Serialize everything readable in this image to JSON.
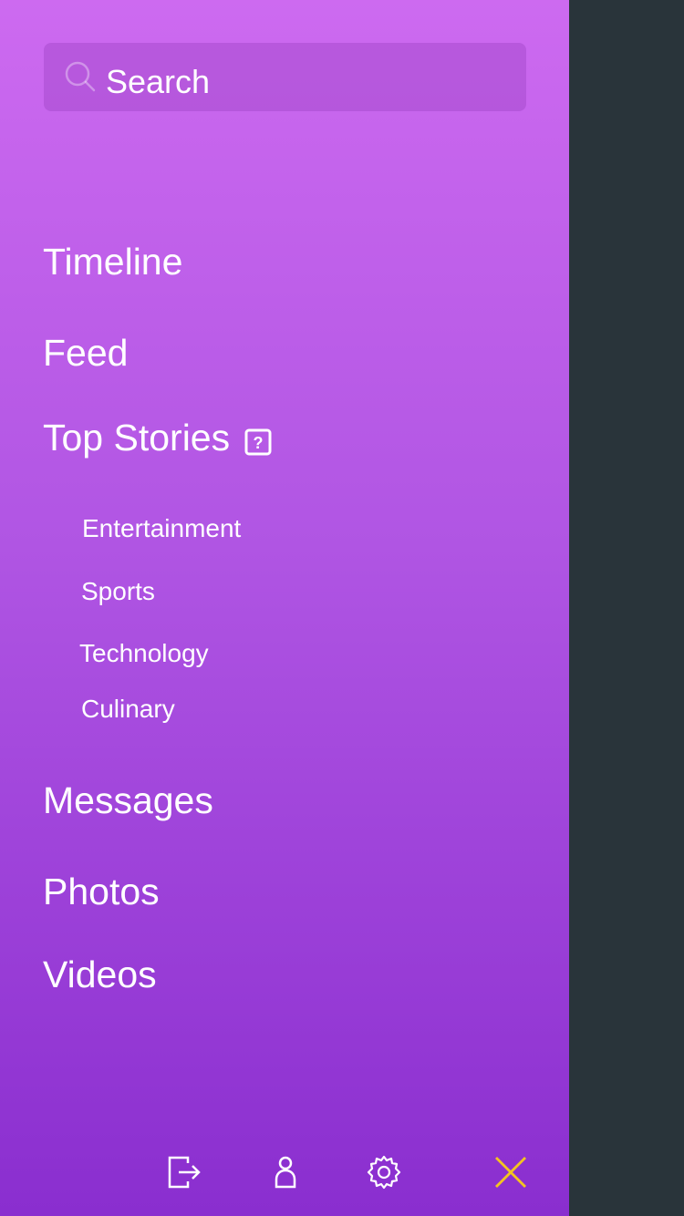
{
  "search": {
    "placeholder": "Search",
    "icon": "search-icon"
  },
  "menu": {
    "items": [
      {
        "label": "Timeline"
      },
      {
        "label": "Feed"
      },
      {
        "label": "Top Stories",
        "icon": "help-icon"
      },
      {
        "label": "Messages"
      },
      {
        "label": "Photos"
      },
      {
        "label": "Videos"
      }
    ],
    "top_stories_sub": [
      {
        "label": "Entertainment"
      },
      {
        "label": "Sports"
      },
      {
        "label": "Technology"
      },
      {
        "label": "Culinary"
      }
    ]
  },
  "toolbar": {
    "icons": [
      "logout-icon",
      "user-icon",
      "settings-icon",
      "close-icon"
    ]
  },
  "colors": {
    "gradient_top": "#cd6af0",
    "gradient_bottom": "#8a2ecf",
    "backdrop": "#29343a",
    "text": "#ffffff",
    "close_accent": "#f4c41f"
  }
}
